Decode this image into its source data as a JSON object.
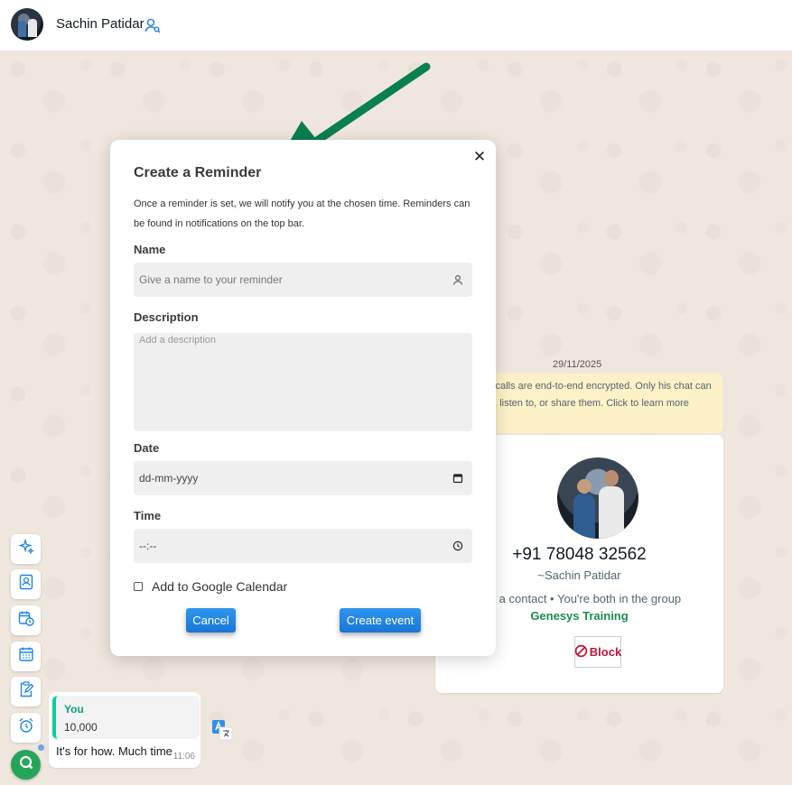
{
  "header": {
    "contact_name": "Sachin Patidar",
    "icons": [
      "avatar",
      "contact-info-icon"
    ]
  },
  "modal": {
    "title": "Create a Reminder",
    "description": "Once a reminder is set, we will notify you at the chosen time. Reminders can be found in notifications on the top bar.",
    "name_label": "Name",
    "name_placeholder": "Give a name to your reminder",
    "description_label": "Description",
    "description_placeholder": "Add a description",
    "date_label": "Date",
    "date_placeholder": "dd-mm-yyyy",
    "time_label": "Time",
    "time_placeholder": "--:--",
    "google_calendar_label": "Add to Google Calendar",
    "google_calendar_checked": false,
    "cancel_label": "Cancel",
    "create_label": "Create event",
    "close_icon": "close-icon"
  },
  "chat": {
    "date": "29/11/2025",
    "encryption_notice": "ages and calls are end-to-end encrypted. Only his chat can read, listen to, or share them. Click to learn more",
    "contact_card": {
      "phone": "+91 78048 32562",
      "name": "~Sachin Patidar",
      "note": "Not a contact • You're both in the group",
      "group": "Genesys Training",
      "block_label": "Block"
    },
    "message": {
      "quote_author": "You",
      "quote_text": "10,000",
      "text": "It's for how. Much time",
      "time": "11:06"
    }
  },
  "sidebar_tools": [
    "sparkle-icon",
    "contact-card-icon",
    "calendar-clock-icon",
    "calendar-icon",
    "clipboard-edit-icon",
    "alarm-clock-icon",
    "app-logo-icon"
  ],
  "colors": {
    "accent_blue": "#1c86e3",
    "arrow_green": "#0a7f4f",
    "group_green": "#1e8d4c",
    "block_red": "#c0163c",
    "banner_yellow": "#fdf1c7"
  }
}
